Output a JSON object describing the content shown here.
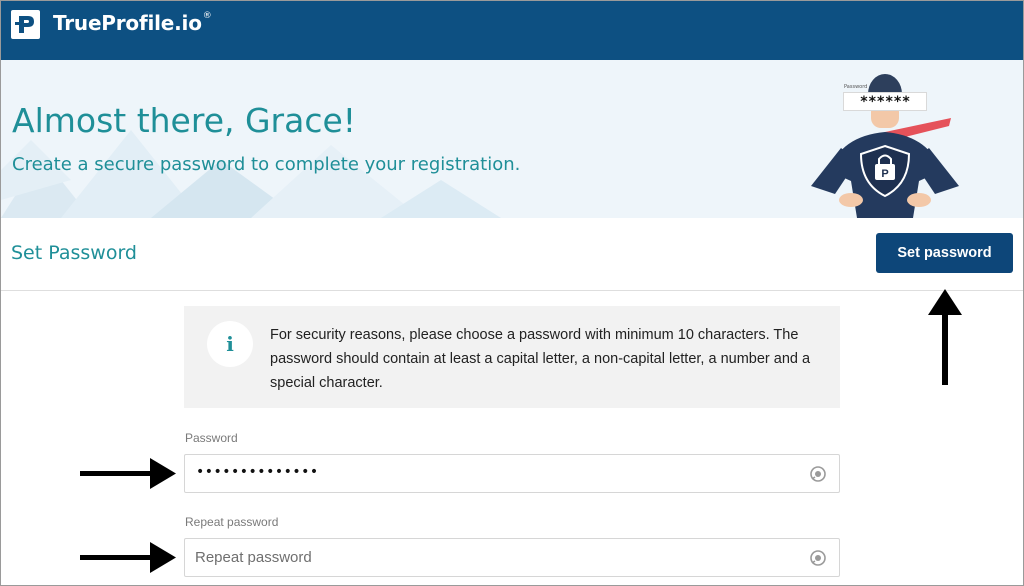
{
  "header": {
    "brand": "TrueProfile.io",
    "trademark": "®"
  },
  "hero": {
    "title": "Almost there, Grace!",
    "subtitle": "Create a secure password to complete your registration.",
    "illustration": {
      "password_label": "Password",
      "password_value": "******"
    }
  },
  "section": {
    "title": "Set Password",
    "button_label": "Set password"
  },
  "notice": {
    "icon": "info-icon",
    "icon_glyph": "i",
    "text": "For security reasons, please choose a password with minimum 10 characters. The password should contain at least a capital letter, a non-capital letter, a number and a special character."
  },
  "form": {
    "password": {
      "label": "Password",
      "masked_value": "••••••••••••••"
    },
    "repeat_password": {
      "label": "Repeat password",
      "placeholder": "Repeat password",
      "value": ""
    }
  },
  "colors": {
    "header_bg": "#0d5082",
    "accent_teal": "#1f8f98",
    "button_bg": "#0d4679",
    "hero_bg": "#eef5fa"
  }
}
